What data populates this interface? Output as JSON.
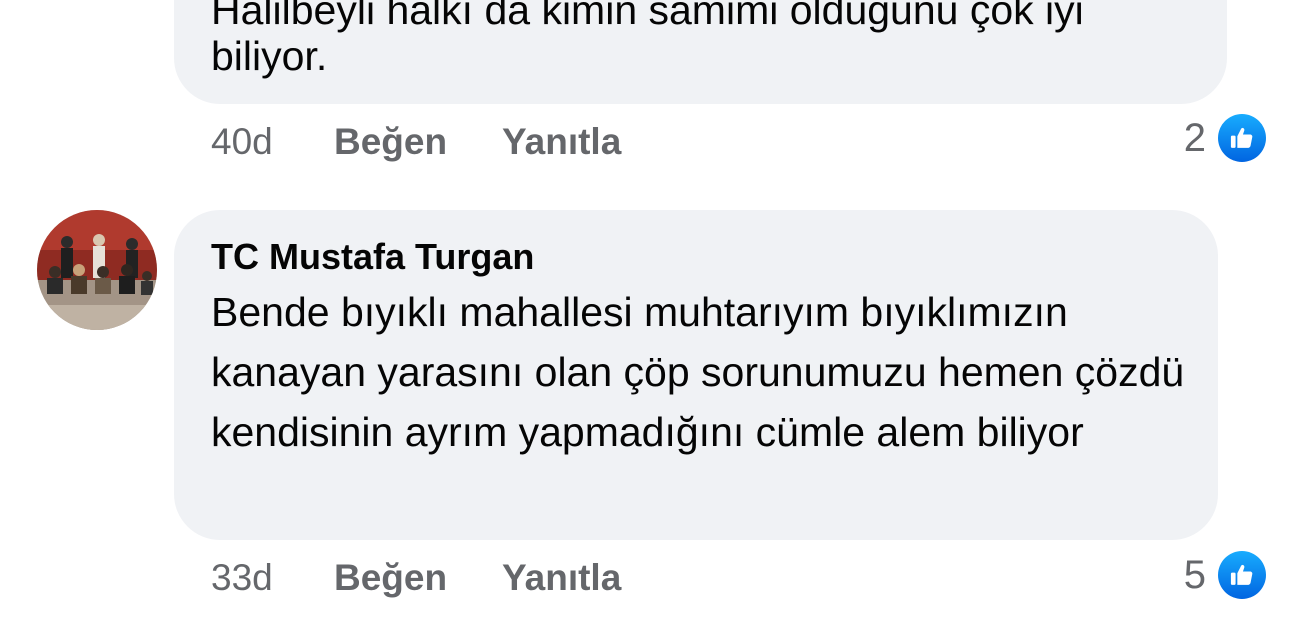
{
  "comments": [
    {
      "partial_text": "Halilbeyli halkı da kimin samimi olduğunu çok iyi",
      "text_last_line": "biliyor.",
      "time": "40d",
      "like_label": "Beğen",
      "reply_label": "Yanıtla",
      "reaction_count": "2"
    },
    {
      "author": "TC Mustafa Turgan",
      "text": "Bende bıyıklı mahallesi muhtarıyım bıyıklımızın kanayan yarasını olan çöp sorunumuzu hemen çözdü kendisinin ayrım yapmadığını cümle alem biliyor",
      "time": "33d",
      "like_label": "Beğen",
      "reply_label": "Yanıtla",
      "reaction_count": "5"
    }
  ],
  "colors": {
    "bubble": "#f0f2f5",
    "text": "#050505",
    "meta": "#65676b",
    "like_badge": "#1b74e4"
  },
  "icons": {
    "reaction": "thumbs-up-icon"
  }
}
